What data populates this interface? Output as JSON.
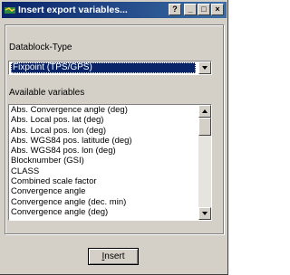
{
  "window": {
    "title": "Insert export variables...",
    "buttons": {
      "help": "?",
      "minimize": "_",
      "maximize": "□",
      "close": "×"
    }
  },
  "datablock": {
    "label": "Datablock-Type",
    "selected": "Fixpoint (TPS/GPS)"
  },
  "variables": {
    "label": "Available variables",
    "items": [
      "Abs. Convergence angle (deg)",
      "Abs. Local pos. lat (deg)",
      "Abs. Local pos. lon (deg)",
      "Abs. WGS84 pos. latitude (deg)",
      "Abs. WGS84 pos. lon (deg)",
      "Blocknumber (GSI)",
      "CLASS",
      "Combined scale factor",
      "Convergence angle",
      "Convergence angle (dec. min)",
      "Convergence angle (deg)"
    ]
  },
  "insert_button": {
    "mnemonic": "I",
    "rest": "nsert"
  },
  "icons": {
    "app": "map-app-icon",
    "combo_arrow": "chevron-down-icon",
    "scroll_up": "scroll-up-arrow-icon",
    "scroll_down": "scroll-down-arrow-icon"
  },
  "colors": {
    "title_bar": "#0a246a",
    "selection": "#0a246a",
    "face": "#d4d0c8"
  }
}
